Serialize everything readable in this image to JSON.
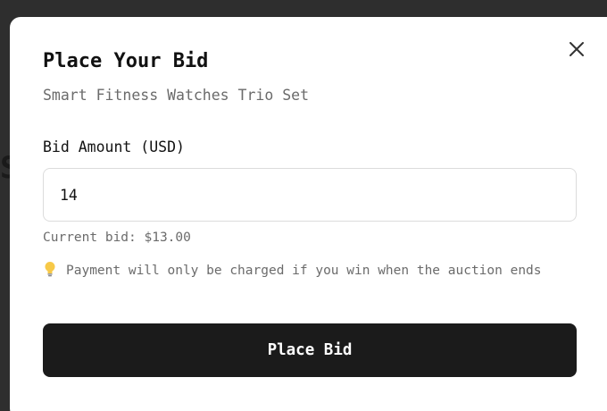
{
  "backdrop": {
    "partial_letter": "S"
  },
  "modal": {
    "title": "Place Your Bid",
    "subtitle": "Smart Fitness Watches Trio Set",
    "close_icon": "close-icon"
  },
  "form": {
    "amount_label": "Bid Amount (USD)",
    "amount_value": "14",
    "current_bid": "Current bid: $13.00",
    "note_icon": "lightbulb-icon",
    "note_text": "Payment will only be charged if you win when the auction ends",
    "submit_label": "Place Bid"
  },
  "colors": {
    "backdrop": "#2e2e2e",
    "modal_bg": "#ffffff",
    "button_bg": "#1b1b1b",
    "muted_text": "#6b6b6b"
  }
}
